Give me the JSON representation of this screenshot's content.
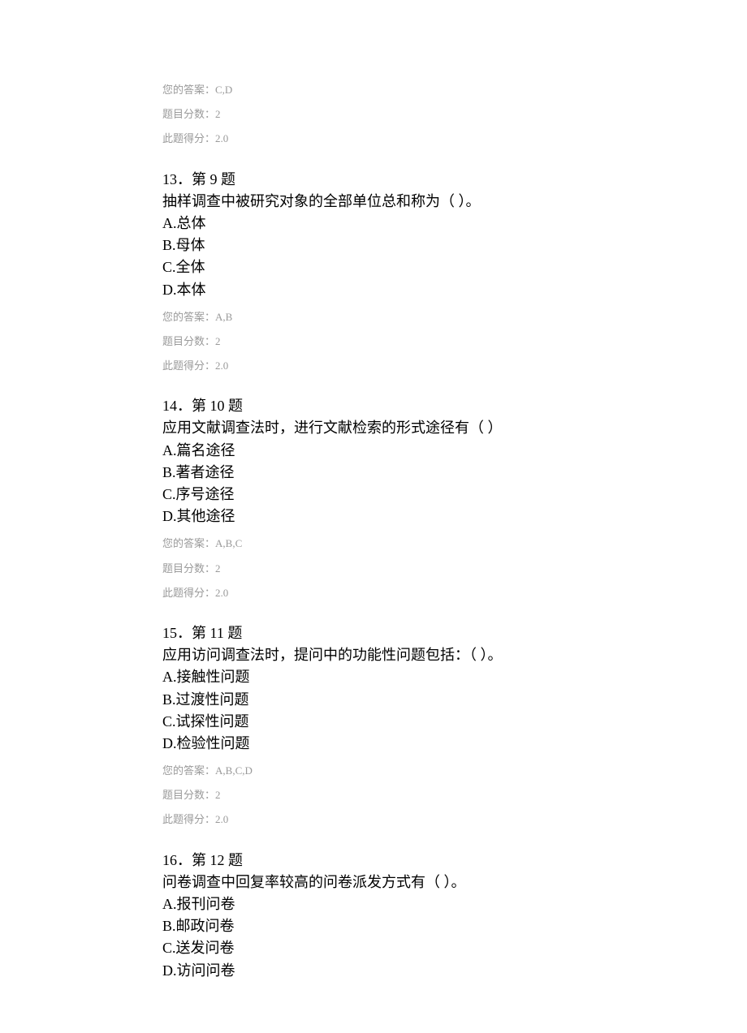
{
  "prev_meta": {
    "your_answer_label": "您的答案：",
    "your_answer_value": "C,D",
    "score_label": "题目分数：",
    "score_value": "2",
    "earned_label": "此题得分：",
    "earned_value": "2.0"
  },
  "questions": [
    {
      "header": "13．第 9 题",
      "text": "抽样调查中被研究对象的全部单位总和称为（ ）。",
      "options": [
        "A.总体",
        "B.母体",
        "C.全体",
        "D.本体"
      ],
      "meta": {
        "your_answer_label": "您的答案：",
        "your_answer_value": "A,B",
        "score_label": "题目分数：",
        "score_value": "2",
        "earned_label": "此题得分：",
        "earned_value": "2.0"
      }
    },
    {
      "header": "14．第 10 题",
      "text": "应用文献调查法时，进行文献检索的形式途径有（ ）",
      "options": [
        "A.篇名途径",
        "B.著者途径",
        "C.序号途径",
        "D.其他途径"
      ],
      "meta": {
        "your_answer_label": "您的答案：",
        "your_answer_value": "A,B,C",
        "score_label": "题目分数：",
        "score_value": "2",
        "earned_label": "此题得分：",
        "earned_value": "2.0"
      }
    },
    {
      "header": "15．第 11 题",
      "text": "应用访问调查法时，提问中的功能性问题包括：（ ）。",
      "options": [
        "A.接触性问题",
        "B.过渡性问题",
        "C.试探性问题",
        "D.检验性问题"
      ],
      "meta": {
        "your_answer_label": "您的答案：",
        "your_answer_value": "A,B,C,D",
        "score_label": "题目分数：",
        "score_value": "2",
        "earned_label": "此题得分：",
        "earned_value": "2.0"
      }
    },
    {
      "header": "16．第 12 题",
      "text": "问卷调查中回复率较高的问卷派发方式有（ ）。",
      "options": [
        "A.报刊问卷",
        "B.邮政问卷",
        "C.送发问卷",
        "D.访问问卷"
      ],
      "meta": null
    }
  ]
}
